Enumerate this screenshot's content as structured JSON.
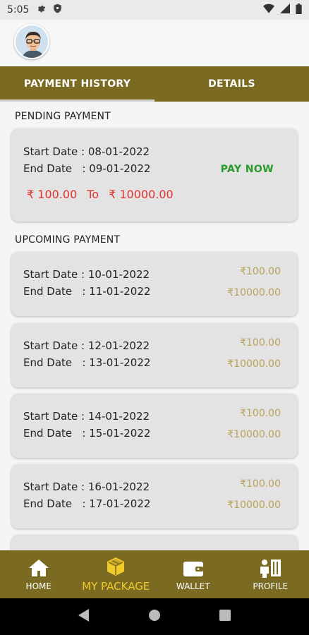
{
  "status_bar": {
    "time": "5:05"
  },
  "tabs": [
    {
      "label": "PAYMENT HISTORY",
      "active": true
    },
    {
      "label": "DETAILS",
      "active": false
    }
  ],
  "pending": {
    "title": "PENDING PAYMENT",
    "start_date": "Start Date : 08-01-2022",
    "end_date": "End Date   : 09-01-2022",
    "pay_now": "PAY NOW",
    "from_amount": "₹ 100.00",
    "to_label": "To",
    "to_amount": "₹ 10000.00"
  },
  "upcoming": {
    "title": "UPCOMING PAYMENT",
    "items": [
      {
        "start_date": "Start Date : 10-01-2022",
        "end_date": "End Date   : 11-01-2022",
        "min": "₹100.00",
        "max": "₹10000.00"
      },
      {
        "start_date": "Start Date : 12-01-2022",
        "end_date": "End Date   : 13-01-2022",
        "min": "₹100.00",
        "max": "₹10000.00"
      },
      {
        "start_date": "Start Date : 14-01-2022",
        "end_date": "End Date   : 15-01-2022",
        "min": "₹100.00",
        "max": "₹10000.00"
      },
      {
        "start_date": "Start Date : 16-01-2022",
        "end_date": "End Date   : 17-01-2022",
        "min": "₹100.00",
        "max": "₹10000.00"
      }
    ]
  },
  "bottom_nav": [
    {
      "label": "HOME",
      "icon": "home-icon",
      "active": false
    },
    {
      "label": "MY PACKAGE",
      "icon": "package-icon",
      "active": true
    },
    {
      "label": "WALLET",
      "icon": "wallet-icon",
      "active": false
    },
    {
      "label": "PROFILE",
      "icon": "profile-icon",
      "active": false
    }
  ],
  "colors": {
    "brand": "#7a6a22",
    "active_nav": "#f1cb2a",
    "pay_now": "#2a9a2a",
    "amount_range": "#e0312f",
    "amount_muted": "#b9a25a"
  }
}
